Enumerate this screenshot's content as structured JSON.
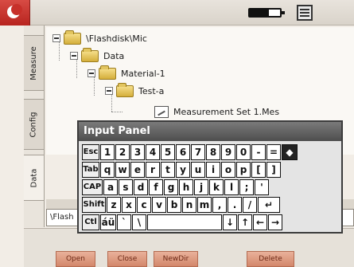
{
  "status": {
    "battery_fraction": 0.62
  },
  "side_tabs": [
    "Measure",
    "Config",
    "Data"
  ],
  "tree": [
    {
      "label": "\\Flashdisk\\Mic",
      "type": "folder",
      "level": 0
    },
    {
      "label": "Data",
      "type": "folder",
      "level": 1
    },
    {
      "label": "Material-1",
      "type": "folder",
      "level": 2
    },
    {
      "label": "Test-a",
      "type": "folder",
      "level": 3
    },
    {
      "label": "Measurement Set 1.Mes",
      "type": "file",
      "level": 4
    }
  ],
  "filename_value": "\\Flash",
  "buttons": [
    "Open",
    "Close",
    "NewDir",
    "Delete"
  ],
  "input_panel": {
    "title": "Input Panel",
    "rows": [
      [
        "Esc",
        "1",
        "2",
        "3",
        "4",
        "5",
        "6",
        "7",
        "8",
        "9",
        "0",
        "-",
        "=",
        "◆"
      ],
      [
        "Tab",
        "q",
        "w",
        "e",
        "r",
        "t",
        "y",
        "u",
        "i",
        "o",
        "p",
        "[",
        "]"
      ],
      [
        "CAP",
        "a",
        "s",
        "d",
        "f",
        "g",
        "h",
        "j",
        "k",
        "l",
        ";",
        "'"
      ],
      [
        "Shift",
        "z",
        "x",
        "c",
        "v",
        "b",
        "n",
        "m",
        ",",
        ".",
        "/",
        "↵"
      ],
      [
        "Ctl",
        "áü",
        "`",
        "\\",
        "",
        "↓",
        "↑",
        "←",
        "→"
      ]
    ]
  }
}
